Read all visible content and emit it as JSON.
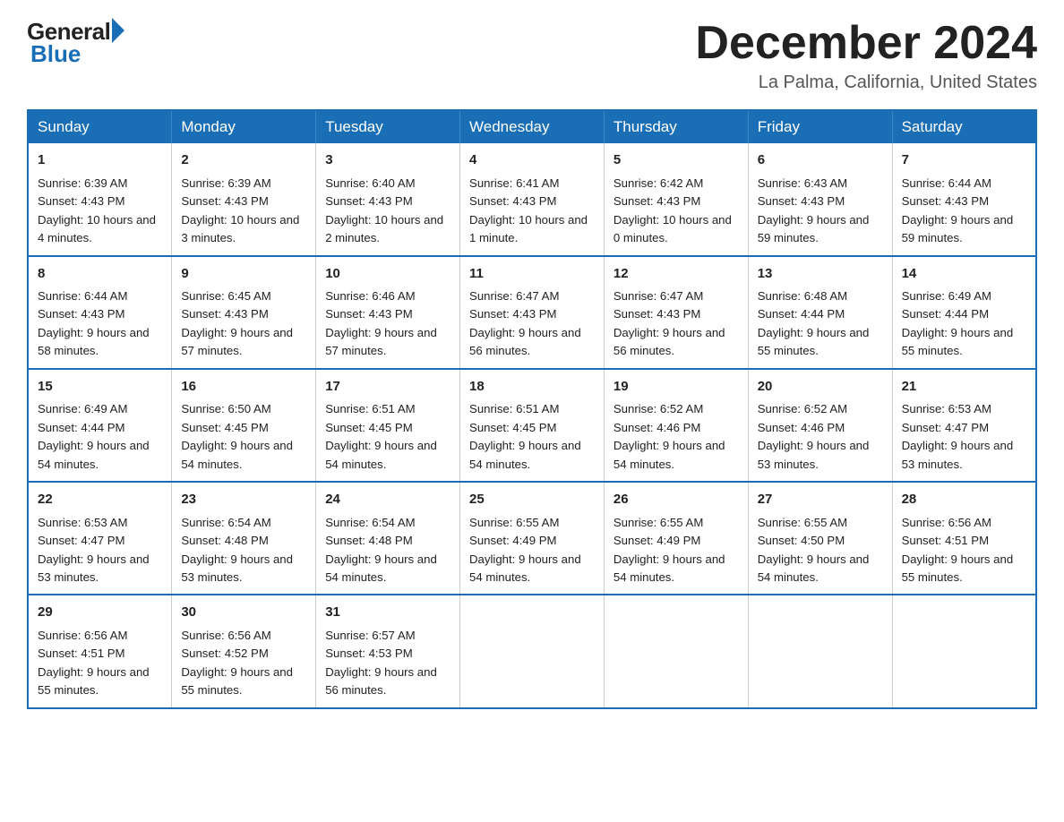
{
  "header": {
    "logo": {
      "general": "General",
      "blue": "Blue"
    },
    "title": "December 2024",
    "location": "La Palma, California, United States"
  },
  "calendar": {
    "days_of_week": [
      "Sunday",
      "Monday",
      "Tuesday",
      "Wednesday",
      "Thursday",
      "Friday",
      "Saturday"
    ],
    "weeks": [
      [
        {
          "day": "1",
          "sunrise": "6:39 AM",
          "sunset": "4:43 PM",
          "daylight": "10 hours and 4 minutes."
        },
        {
          "day": "2",
          "sunrise": "6:39 AM",
          "sunset": "4:43 PM",
          "daylight": "10 hours and 3 minutes."
        },
        {
          "day": "3",
          "sunrise": "6:40 AM",
          "sunset": "4:43 PM",
          "daylight": "10 hours and 2 minutes."
        },
        {
          "day": "4",
          "sunrise": "6:41 AM",
          "sunset": "4:43 PM",
          "daylight": "10 hours and 1 minute."
        },
        {
          "day": "5",
          "sunrise": "6:42 AM",
          "sunset": "4:43 PM",
          "daylight": "10 hours and 0 minutes."
        },
        {
          "day": "6",
          "sunrise": "6:43 AM",
          "sunset": "4:43 PM",
          "daylight": "9 hours and 59 minutes."
        },
        {
          "day": "7",
          "sunrise": "6:44 AM",
          "sunset": "4:43 PM",
          "daylight": "9 hours and 59 minutes."
        }
      ],
      [
        {
          "day": "8",
          "sunrise": "6:44 AM",
          "sunset": "4:43 PM",
          "daylight": "9 hours and 58 minutes."
        },
        {
          "day": "9",
          "sunrise": "6:45 AM",
          "sunset": "4:43 PM",
          "daylight": "9 hours and 57 minutes."
        },
        {
          "day": "10",
          "sunrise": "6:46 AM",
          "sunset": "4:43 PM",
          "daylight": "9 hours and 57 minutes."
        },
        {
          "day": "11",
          "sunrise": "6:47 AM",
          "sunset": "4:43 PM",
          "daylight": "9 hours and 56 minutes."
        },
        {
          "day": "12",
          "sunrise": "6:47 AM",
          "sunset": "4:43 PM",
          "daylight": "9 hours and 56 minutes."
        },
        {
          "day": "13",
          "sunrise": "6:48 AM",
          "sunset": "4:44 PM",
          "daylight": "9 hours and 55 minutes."
        },
        {
          "day": "14",
          "sunrise": "6:49 AM",
          "sunset": "4:44 PM",
          "daylight": "9 hours and 55 minutes."
        }
      ],
      [
        {
          "day": "15",
          "sunrise": "6:49 AM",
          "sunset": "4:44 PM",
          "daylight": "9 hours and 54 minutes."
        },
        {
          "day": "16",
          "sunrise": "6:50 AM",
          "sunset": "4:45 PM",
          "daylight": "9 hours and 54 minutes."
        },
        {
          "day": "17",
          "sunrise": "6:51 AM",
          "sunset": "4:45 PM",
          "daylight": "9 hours and 54 minutes."
        },
        {
          "day": "18",
          "sunrise": "6:51 AM",
          "sunset": "4:45 PM",
          "daylight": "9 hours and 54 minutes."
        },
        {
          "day": "19",
          "sunrise": "6:52 AM",
          "sunset": "4:46 PM",
          "daylight": "9 hours and 54 minutes."
        },
        {
          "day": "20",
          "sunrise": "6:52 AM",
          "sunset": "4:46 PM",
          "daylight": "9 hours and 53 minutes."
        },
        {
          "day": "21",
          "sunrise": "6:53 AM",
          "sunset": "4:47 PM",
          "daylight": "9 hours and 53 minutes."
        }
      ],
      [
        {
          "day": "22",
          "sunrise": "6:53 AM",
          "sunset": "4:47 PM",
          "daylight": "9 hours and 53 minutes."
        },
        {
          "day": "23",
          "sunrise": "6:54 AM",
          "sunset": "4:48 PM",
          "daylight": "9 hours and 53 minutes."
        },
        {
          "day": "24",
          "sunrise": "6:54 AM",
          "sunset": "4:48 PM",
          "daylight": "9 hours and 54 minutes."
        },
        {
          "day": "25",
          "sunrise": "6:55 AM",
          "sunset": "4:49 PM",
          "daylight": "9 hours and 54 minutes."
        },
        {
          "day": "26",
          "sunrise": "6:55 AM",
          "sunset": "4:49 PM",
          "daylight": "9 hours and 54 minutes."
        },
        {
          "day": "27",
          "sunrise": "6:55 AM",
          "sunset": "4:50 PM",
          "daylight": "9 hours and 54 minutes."
        },
        {
          "day": "28",
          "sunrise": "6:56 AM",
          "sunset": "4:51 PM",
          "daylight": "9 hours and 55 minutes."
        }
      ],
      [
        {
          "day": "29",
          "sunrise": "6:56 AM",
          "sunset": "4:51 PM",
          "daylight": "9 hours and 55 minutes."
        },
        {
          "day": "30",
          "sunrise": "6:56 AM",
          "sunset": "4:52 PM",
          "daylight": "9 hours and 55 minutes."
        },
        {
          "day": "31",
          "sunrise": "6:57 AM",
          "sunset": "4:53 PM",
          "daylight": "9 hours and 56 minutes."
        },
        null,
        null,
        null,
        null
      ]
    ]
  }
}
